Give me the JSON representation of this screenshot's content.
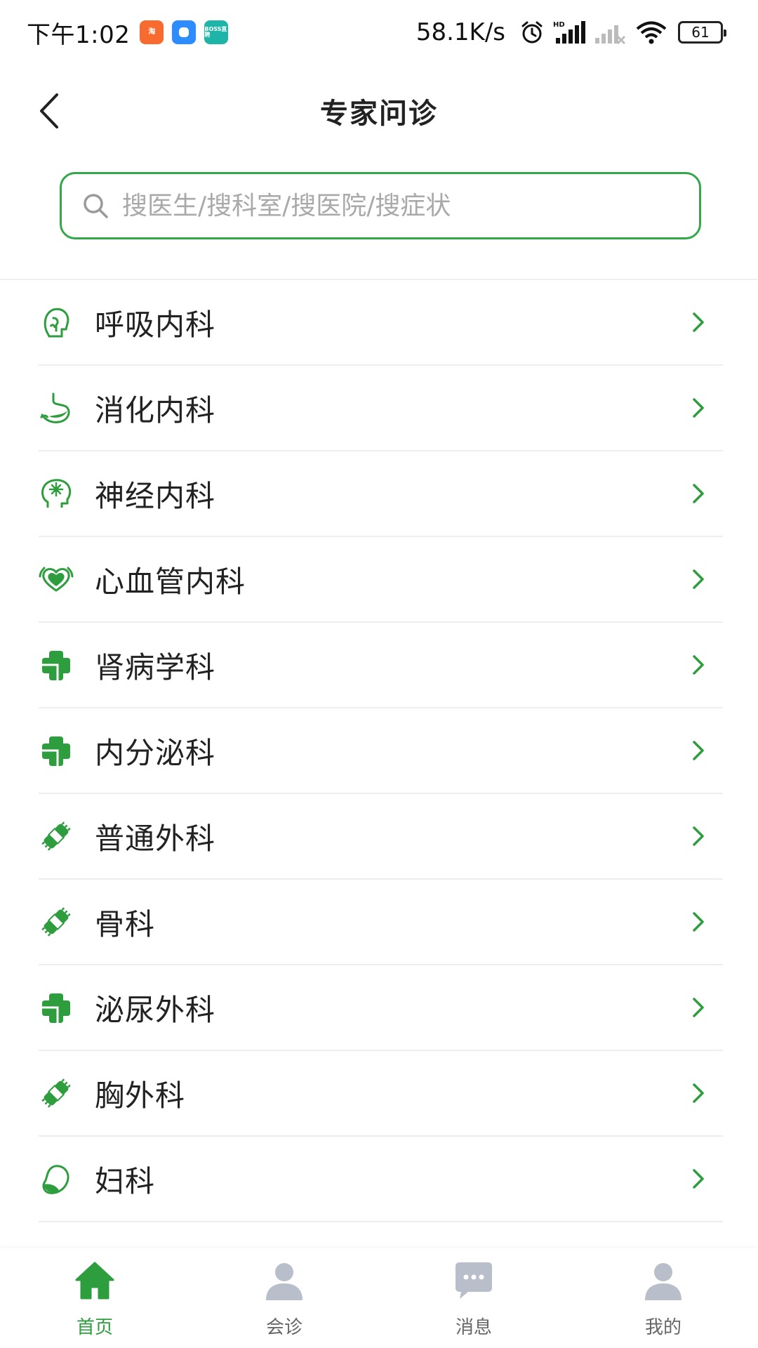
{
  "status_bar": {
    "time": "下午1:02",
    "apps": [
      {
        "name": "taobao-app-icon",
        "text": "淘"
      },
      {
        "name": "blue-app-icon",
        "text": ""
      },
      {
        "name": "boss-app-icon",
        "text": "BOSS直聘"
      }
    ],
    "net_speed": "58.1K/s",
    "battery": "61"
  },
  "header": {
    "title": "专家问诊"
  },
  "search": {
    "placeholder": "搜医生/搜科室/搜医院/搜症状",
    "value": ""
  },
  "departments": [
    {
      "label": "呼吸内科",
      "icon": "respiratory-icon"
    },
    {
      "label": "消化内科",
      "icon": "stomach-icon"
    },
    {
      "label": "神经内科",
      "icon": "brain-icon"
    },
    {
      "label": "心血管内科",
      "icon": "heart-icon"
    },
    {
      "label": "肾病学科",
      "icon": "medical-cross-icon"
    },
    {
      "label": "内分泌科",
      "icon": "medical-cross-icon"
    },
    {
      "label": "普通外科",
      "icon": "bandage-icon"
    },
    {
      "label": "骨科",
      "icon": "bandage-icon"
    },
    {
      "label": "泌尿外科",
      "icon": "medical-cross-icon"
    },
    {
      "label": "胸外科",
      "icon": "bandage-icon"
    },
    {
      "label": "妇科",
      "icon": "uterus-icon"
    }
  ],
  "bottom_nav": [
    {
      "label": "首页",
      "icon": "home-icon",
      "active": true
    },
    {
      "label": "会诊",
      "icon": "consult-icon",
      "active": false
    },
    {
      "label": "消息",
      "icon": "message-icon",
      "active": false
    },
    {
      "label": "我的",
      "icon": "profile-icon",
      "active": false
    }
  ],
  "colors": {
    "accent": "#2e9d3e",
    "search_border": "#32a84a",
    "nav_inactive": "#b8bfca"
  }
}
